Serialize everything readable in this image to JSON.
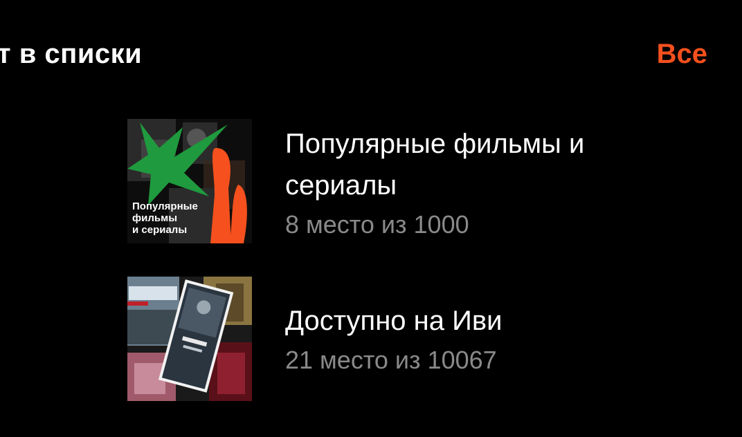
{
  "header": {
    "title": "т в списки",
    "see_all_label": "Все"
  },
  "colors": {
    "accent": "#f5501e",
    "background": "#000000",
    "secondary_text": "#8a8a8a",
    "cover_green": "#1f9a3e"
  },
  "lists": [
    {
      "title": "Популярные фильмы и сериалы",
      "subtitle": "8 место из 1000",
      "cover_caption": [
        "Популярные",
        "фильмы",
        "и сериалы"
      ],
      "cover_icon": "green-starburst-and-orange-shape"
    },
    {
      "title": "Доступно на Иви",
      "subtitle": "21 место из 10067",
      "cover_icon": "movie-posters-collage"
    }
  ]
}
